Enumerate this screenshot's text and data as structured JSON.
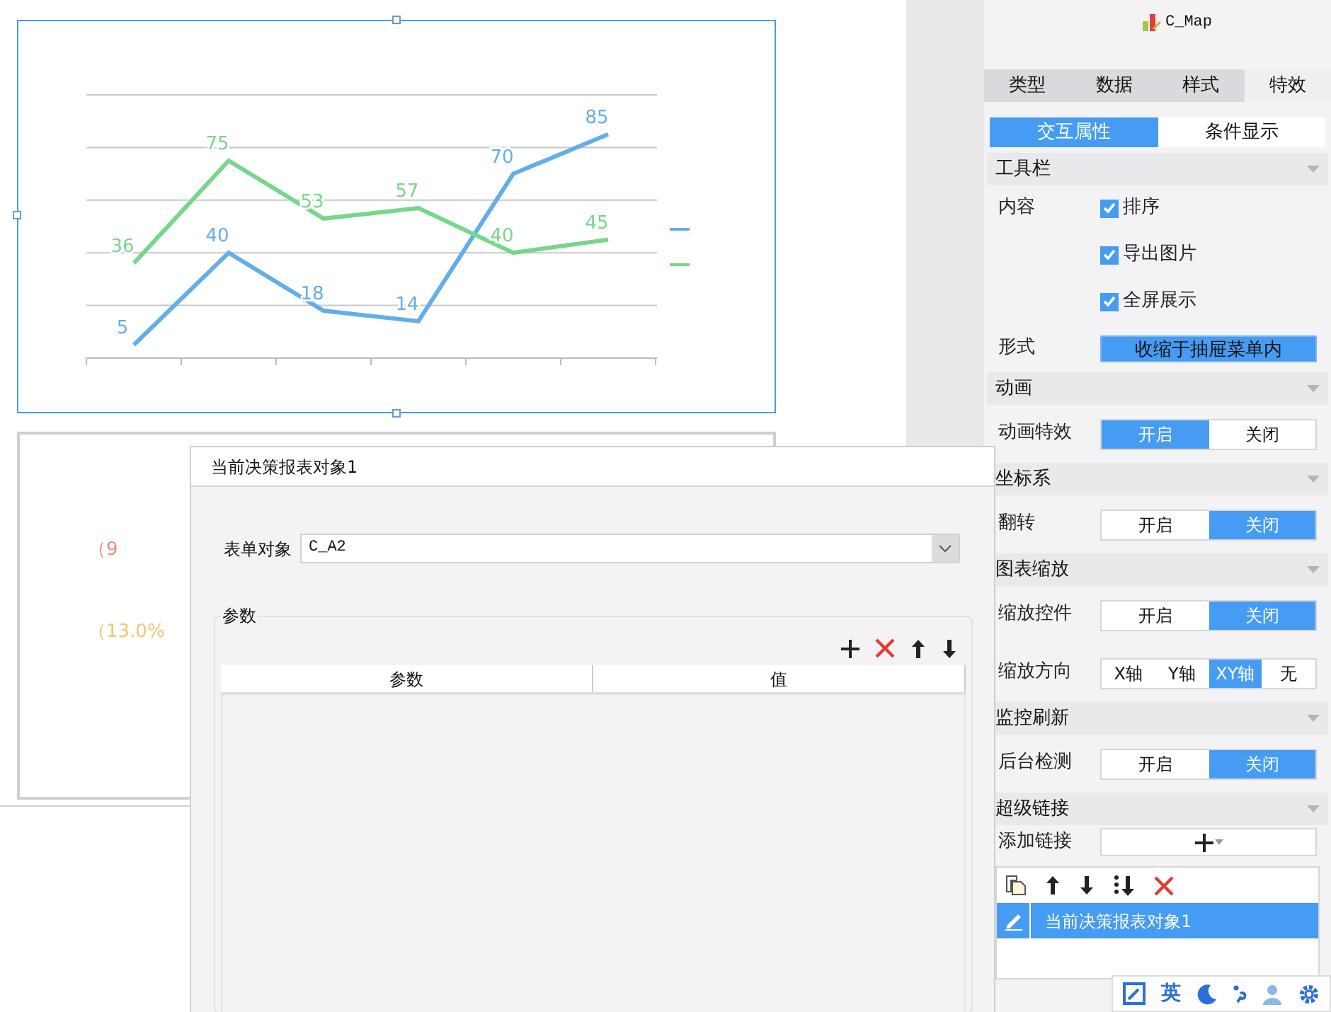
{
  "canvas": {
    "chart": {
      "chart_data": {
        "type": "line",
        "ylim": [
          0,
          100
        ],
        "data_labels": true,
        "series": [
          {
            "color": "#63aee9",
            "values": [
              5,
              40,
              18,
              14,
              70,
              85
            ]
          },
          {
            "color": "#77d68a",
            "values": [
              36,
              75,
              53,
              57,
              40,
              45
            ]
          }
        ]
      }
    },
    "partial_labels": [
      {
        "text": "（9",
        "color": "#f28b82"
      },
      {
        "text": "（13.0%",
        "color": "#f6c56f"
      }
    ]
  },
  "tree": {
    "items": [
      {
        "label": "C_Map"
      }
    ]
  },
  "panel": {
    "tabs": [
      {
        "label": "类型",
        "selected": false
      },
      {
        "label": "数据",
        "selected": false
      },
      {
        "label": "样式",
        "selected": false
      },
      {
        "label": "特效",
        "selected": true
      }
    ],
    "subtabs": [
      {
        "label": "交互属性",
        "selected": true
      },
      {
        "label": "条件显示",
        "selected": false
      }
    ],
    "sections": [
      {
        "title": "工具栏",
        "rows": [
          {
            "kind": "checkbox",
            "label": "内容",
            "options": [
              {
                "label": "排序",
                "checked": true
              },
              {
                "label": "导出图片",
                "checked": true
              },
              {
                "label": "全屏展示",
                "checked": true
              }
            ]
          },
          {
            "kind": "dropdown",
            "label": "形式",
            "value": "收缩于抽屉菜单内"
          }
        ]
      },
      {
        "title": "动画",
        "rows": [
          {
            "kind": "toggle",
            "label": "动画特效",
            "options": [
              {
                "label": "开启",
                "selected": true
              },
              {
                "label": "关闭",
                "selected": false
              }
            ]
          }
        ]
      },
      {
        "title": "坐标系",
        "rows": [
          {
            "kind": "toggle",
            "label": "翻转",
            "options": [
              {
                "label": "开启",
                "selected": false
              },
              {
                "label": "关闭",
                "selected": true
              }
            ]
          }
        ]
      },
      {
        "title": "图表缩放",
        "rows": [
          {
            "kind": "toggle",
            "label": "缩放控件",
            "options": [
              {
                "label": "开启",
                "selected": false
              },
              {
                "label": "关闭",
                "selected": true
              }
            ]
          },
          {
            "kind": "toggle",
            "label": "缩放方向",
            "options": [
              {
                "label": "X轴",
                "selected": false
              },
              {
                "label": "Y轴",
                "selected": false
              },
              {
                "label": "XY轴",
                "selected": true
              },
              {
                "label": "无",
                "selected": false
              }
            ]
          }
        ]
      },
      {
        "title": "监控刷新",
        "rows": [
          {
            "kind": "toggle",
            "label": "后台检测",
            "options": [
              {
                "label": "开启",
                "selected": false
              },
              {
                "label": "关闭",
                "selected": true
              }
            ]
          }
        ]
      },
      {
        "title": "超级链接",
        "rows": [
          {
            "kind": "add",
            "label": "添加链接"
          }
        ]
      }
    ],
    "links": [
      {
        "label": "当前决策报表对象1",
        "selected": true
      }
    ]
  },
  "dialog": {
    "title": "当前决策报表对象1",
    "form_label": "表单对象",
    "form_value": "C_A2",
    "group_title": "参数",
    "table": {
      "columns": [
        "参数",
        "值"
      ]
    }
  },
  "ime_bar": {
    "language": "英"
  }
}
